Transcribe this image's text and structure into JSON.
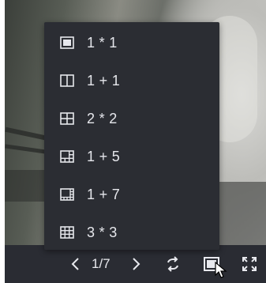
{
  "layout_menu": {
    "items": [
      {
        "label": "1 * 1",
        "icon": "layout-1x1-icon"
      },
      {
        "label": "1 + 1",
        "icon": "layout-1plus1-icon"
      },
      {
        "label": "2 * 2",
        "icon": "layout-2x2-icon"
      },
      {
        "label": "1 + 5",
        "icon": "layout-1plus5-icon"
      },
      {
        "label": "1 + 7",
        "icon": "layout-1plus7-icon"
      },
      {
        "label": "3 * 3",
        "icon": "layout-3x3-icon"
      }
    ]
  },
  "toolbar": {
    "page_indicator": "1/7",
    "prev_icon": "chevron-left-icon",
    "next_icon": "chevron-right-icon",
    "cycle_icon": "cycle-icon",
    "layout_icon": "layout-single-icon",
    "fullscreen_icon": "fullscreen-icon"
  },
  "colors": {
    "menu_background": "#2b2d33",
    "toolbar_background": "#2a2c33",
    "text": "#e6e7ec"
  }
}
